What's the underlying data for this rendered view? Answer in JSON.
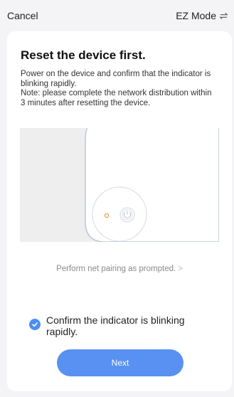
{
  "header": {
    "cancel_label": "Cancel",
    "mode_label": "EZ Mode",
    "mode_icon": "swap-arrows-icon"
  },
  "card": {
    "title": "Reset the device first.",
    "description_lines": [
      "Power on the device and confirm that the indicator is blinking rapidly.",
      "Note: please complete the network distribution within 3 minutes after resetting the device."
    ],
    "illustration_icon": "device-reset-illustration",
    "prompt_link": "Perform net pairing as prompted.",
    "prompt_chevron": ">",
    "confirm_label": "Confirm the indicator is blinking rapidly.",
    "confirm_checked": true,
    "next_label": "Next"
  },
  "colors": {
    "accent": "#5891f1",
    "indicator": "#e8964a"
  }
}
